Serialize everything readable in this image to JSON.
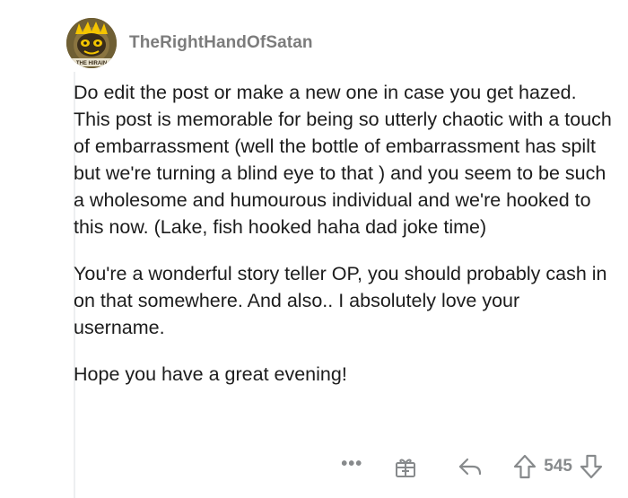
{
  "comment": {
    "author": "TheRightHandOfSatan",
    "paragraphs": [
      "Do edit the post or make a new one in case you get hazed. This post is memorable for being so utterly chaotic with a touch of embarrassment (well the bottle of embarrassment has spilt but we're turning a blind eye to that ) and you seem to be such a wholesome and humourous individual and we're hooked to this now. (Lake, fish hooked haha dad joke time)",
      "You're a wonderful story teller OP, you should probably cash in on that somewhere. And also.. I absolutely love your username.",
      "Hope you have a great evening!"
    ],
    "actions": {
      "more": "•••",
      "score": "545"
    },
    "icons": {
      "more": "more-options-icon",
      "award": "award-gift-icon",
      "reply": "reply-arrow-icon",
      "upvote": "upvote-arrow-icon",
      "downvote": "downvote-arrow-icon"
    },
    "avatar_lettering": "THE HIRAIN",
    "colors": {
      "text": "#1c1c1c",
      "meta": "#7c7c7c",
      "icon": "#878a8c",
      "avatar_bg": "#7a6a3c"
    }
  }
}
